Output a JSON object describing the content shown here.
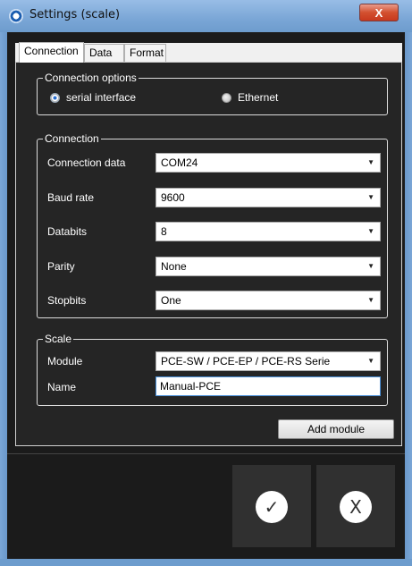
{
  "window": {
    "title": "Settings (scale)",
    "close_glyph": "X"
  },
  "tabs": [
    {
      "label": "Connection",
      "active": true
    },
    {
      "label": "Data",
      "active": false
    },
    {
      "label": "Format",
      "active": false
    }
  ],
  "connection_options": {
    "legend": "Connection options",
    "options": [
      {
        "label": "serial interface",
        "selected": true
      },
      {
        "label": "Ethernet",
        "selected": false
      }
    ]
  },
  "connection": {
    "legend": "Connection",
    "fields": [
      {
        "label": "Connection data",
        "value": "COM24"
      },
      {
        "label": "Baud rate",
        "value": "9600"
      },
      {
        "label": "Databits",
        "value": "8"
      },
      {
        "label": "Parity",
        "value": "None"
      },
      {
        "label": "Stopbits",
        "value": "One"
      }
    ]
  },
  "scale": {
    "legend": "Scale",
    "module_label": "Module",
    "module_value": "PCE-SW / PCE-EP / PCE-RS Serie",
    "name_label": "Name",
    "name_value": "Manual-PCE"
  },
  "add_module_label": "Add module",
  "footer": {
    "ok_glyph": "✓",
    "cancel_glyph": "X"
  },
  "icons": {
    "dropdown": "chevron-down-icon",
    "ok": "checkmark-icon",
    "cancel": "close-icon",
    "app": "app-icon"
  }
}
